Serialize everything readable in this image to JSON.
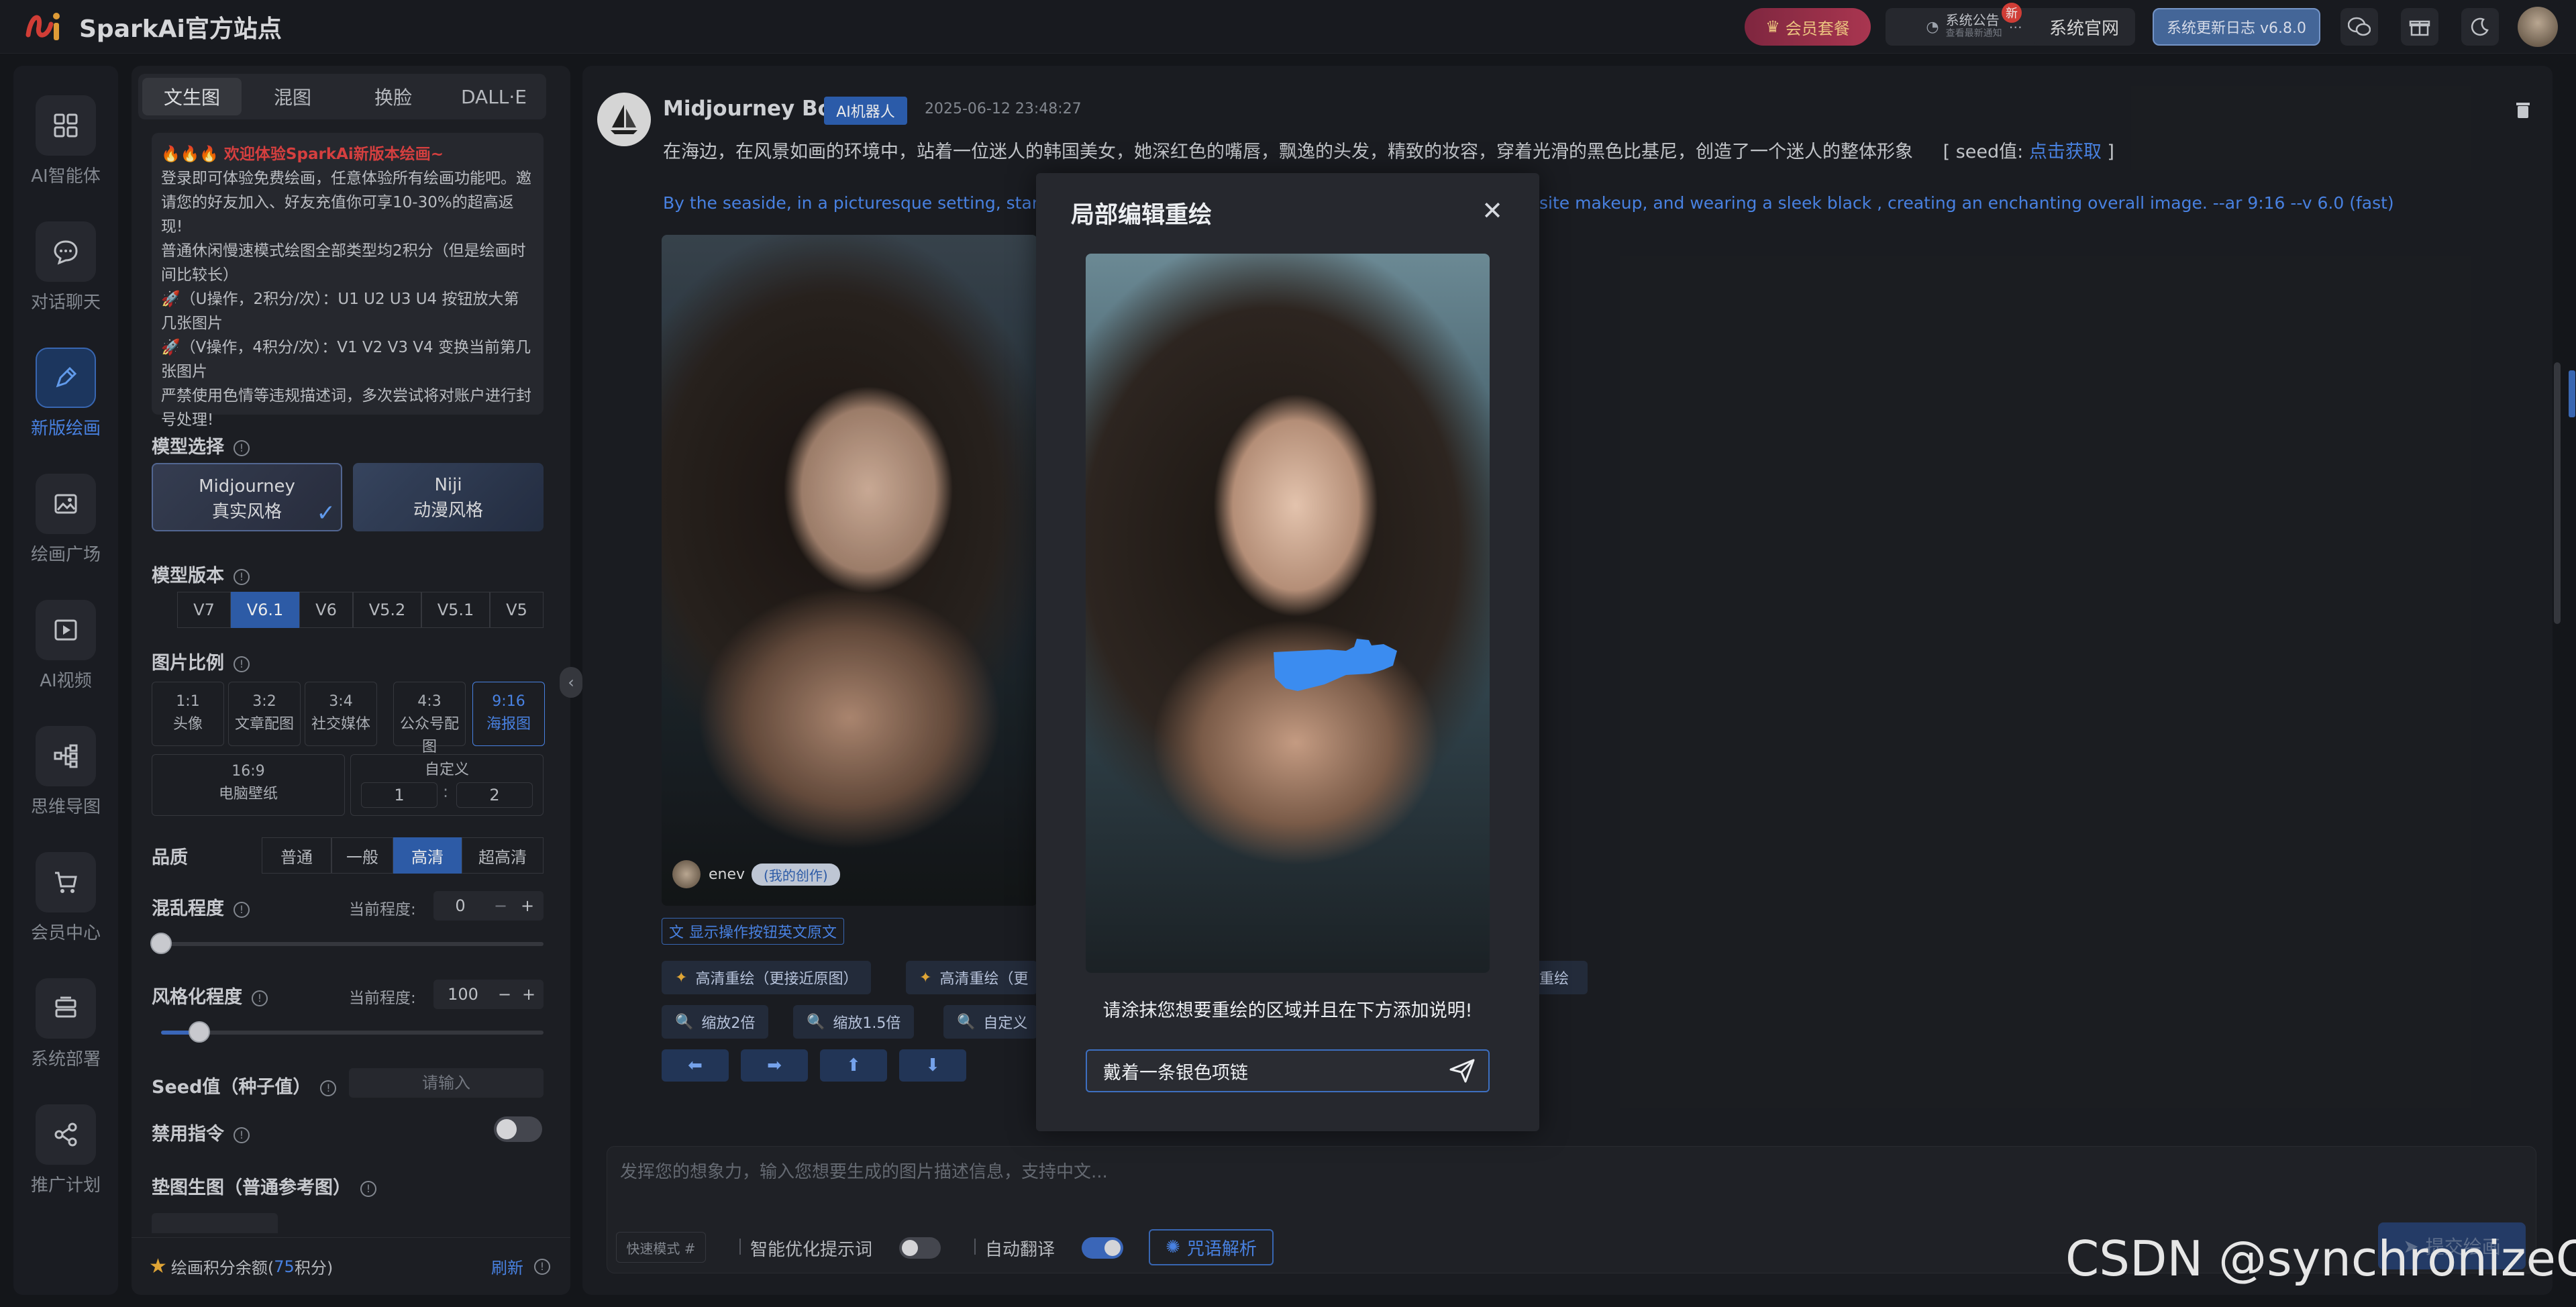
{
  "header": {
    "app_title": "SparkAi官方站点",
    "vip_label": "会员套餐",
    "notice_label": "系统公告",
    "notice_sub": "查看最新通知",
    "notice_badge": "新",
    "site_label": "系统官网",
    "update_label": "系统更新日志 v6.8.0"
  },
  "nav": {
    "items": [
      {
        "label": "AI智能体",
        "icon": "grid-icon"
      },
      {
        "label": "对话聊天",
        "icon": "chat-icon"
      },
      {
        "label": "新版绘画",
        "icon": "paint-icon"
      },
      {
        "label": "绘画广场",
        "icon": "gallery-icon"
      },
      {
        "label": "AI视频",
        "icon": "video-icon"
      },
      {
        "label": "思维导图",
        "icon": "mindmap-icon"
      },
      {
        "label": "会员中心",
        "icon": "cart-icon"
      },
      {
        "label": "系统部署",
        "icon": "server-icon"
      },
      {
        "label": "推广计划",
        "icon": "share-icon"
      }
    ]
  },
  "panel": {
    "tabs": [
      "文生图",
      "混图",
      "换脸",
      "DALL·E"
    ],
    "welcome": {
      "title": "🔥🔥🔥 欢迎体验SparkAi新版本绘画~",
      "lines": [
        "登录即可体验免费绘画，任意体验所有绘画功能吧。邀请您的好友加入、好友充值你可享10-30%的超高返现!",
        "普通休闲慢速模式绘图全部类型均2积分（但是绘画时间比较长）",
        "🚀（U操作，2积分/次）：U1 U2 U3 U4 按钮放大第几张图片",
        "🚀（V操作，4积分/次）：V1 V2 V3 V4 变换当前第几张图片",
        "严禁使用色情等违规描述词，多次尝试将对账户进行封号处理!"
      ]
    },
    "model_title": "模型选择",
    "models": [
      {
        "name": "Midjourney",
        "style": "真实风格"
      },
      {
        "name": "Niji",
        "style": "动漫风格"
      }
    ],
    "version_title": "模型版本",
    "versions": [
      "V7",
      "V6.1",
      "V6",
      "V5.2",
      "V5.1",
      "V5"
    ],
    "ratio_title": "图片比例",
    "ratios": [
      {
        "value": "1:1",
        "label": "头像"
      },
      {
        "value": "3:2",
        "label": "文章配图"
      },
      {
        "value": "3:4",
        "label": "社交媒体"
      },
      {
        "value": "4:3",
        "label": "公众号配图"
      },
      {
        "value": "9:16",
        "label": "海报图"
      }
    ],
    "ratio_wide": {
      "value": "16:9",
      "label": "电脑壁纸"
    },
    "ratio_custom": {
      "label": "自定义",
      "w": "1",
      "sep": ":",
      "h": "2"
    },
    "quality_title": "品质",
    "qualities": [
      "普通",
      "一般",
      "高清",
      "超高清"
    ],
    "chaos_title": "混乱程度",
    "current_label": "当前程度:",
    "chaos_value": "0",
    "chaos_level": 0,
    "stylize_title": "风格化程度",
    "stylize_value": "100",
    "stylize_level": 0.1,
    "seed_title": "Seed值（种子值）",
    "seed_placeholder": "请输入",
    "ban_title": "禁用指令",
    "ref_title": "垫图生图（普通参考图）",
    "footer_label": "绘画积分余额(",
    "footer_points": "75",
    "footer_unit": "积分)",
    "footer_refresh": "刷新"
  },
  "message": {
    "bot_name": "Midjourney Bot",
    "bot_badge": "AI机器人",
    "time": "2025-06-12 23:48:27",
    "prompt_cn": "在海边，在风景如画的环境中，站着一位迷人的韩国美女，她深红色的嘴唇，飘逸的头发，精致的妆容，穿着光滑的黑色比基尼，创造了一个迷人的整体形象",
    "seed_prefix": "[ seed值: ",
    "seed_link": "点击获取",
    "seed_suffix": " ]",
    "prompt_en_a": "By the seaside, in a picturesque setting, stands",
    "prompt_en_b": "site makeup, and wearing a sleek black , creating an enchanting overall image. --ar 9:16 --v 6.0  (fast)",
    "img_user": "enev",
    "img_user_tag": "(我的创作)",
    "show_en_label": "显示操作按钮英文原文",
    "actions_row1": [
      "高清重绘（更接近原图）",
      "高清重绘（更",
      "重绘"
    ],
    "actions_row2": [
      "缩放2倍",
      "缩放1.5倍",
      "自定义"
    ],
    "arrows": [
      "⬅",
      "➡",
      "⬆",
      "⬇"
    ]
  },
  "composer": {
    "placeholder": "发挥您的想象力，输入您想要生成的图片描述信息，支持中文...",
    "quick_mode": "快速模式 #",
    "smart_label": "智能优化提示词",
    "translate_label": "自动翻译",
    "parse_label": "咒语解析",
    "submit_label": "提交绘画"
  },
  "modal": {
    "title": "局部编辑重绘",
    "hint": "请涂抹您想要重绘的区域并且在下方添加说明!",
    "input_value": "戴着一条银色项链",
    "brush_color": "#3b8cf0"
  },
  "watermark": "CSDN @synchronizeOn"
}
